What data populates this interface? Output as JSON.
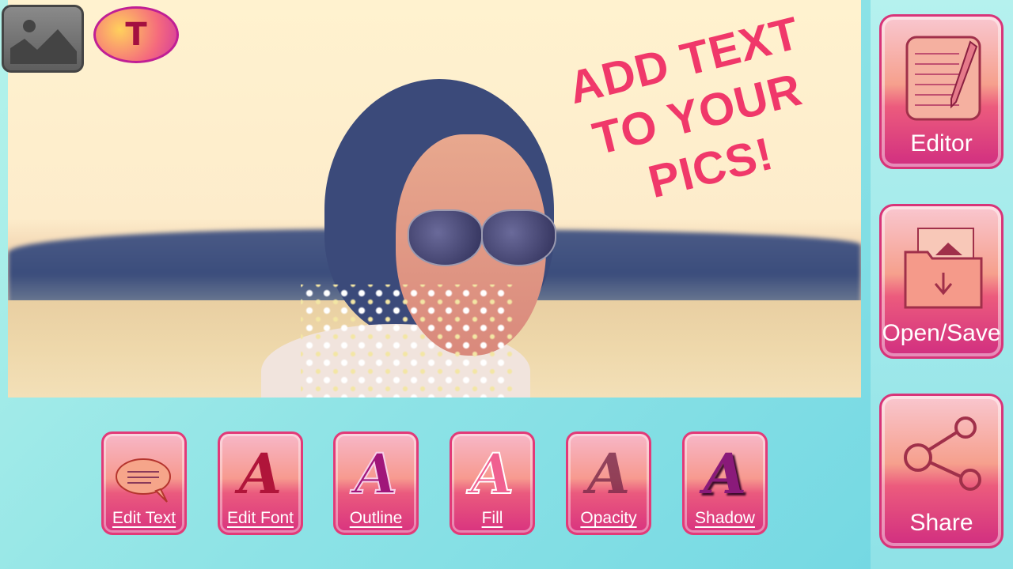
{
  "headline": {
    "line1": "ADD TEXT",
    "line2": "TO YOUR PICS!"
  },
  "top_icons": {
    "gallery": "image-gallery-icon",
    "text": "T"
  },
  "toolbar": [
    {
      "label": "Edit Text",
      "icon": "speech-bubble-icon"
    },
    {
      "label": "Edit Font",
      "icon": "letter-a-icon",
      "glyph": "A",
      "color": "#b0153a"
    },
    {
      "label": "Outline",
      "icon": "letter-a-outline-icon",
      "glyph": "A",
      "color": "#a0167a"
    },
    {
      "label": "Fill",
      "icon": "letter-a-fill-icon",
      "glyph": "A",
      "color": "#f06090"
    },
    {
      "label": "Opacity",
      "icon": "letter-a-opacity-icon",
      "glyph": "A",
      "color": "#7a2a4a"
    },
    {
      "label": "Shadow",
      "icon": "letter-a-shadow-icon",
      "glyph": "A",
      "color": "#8a1a7a"
    }
  ],
  "side": [
    {
      "label": "Editor",
      "icon": "notepad-pencil-icon"
    },
    {
      "label": "Open/Save",
      "icon": "folder-image-icon"
    },
    {
      "label": "Share",
      "icon": "share-icon"
    }
  ],
  "colors": {
    "accent": "#f0386a",
    "background": "#8ee3e6"
  }
}
